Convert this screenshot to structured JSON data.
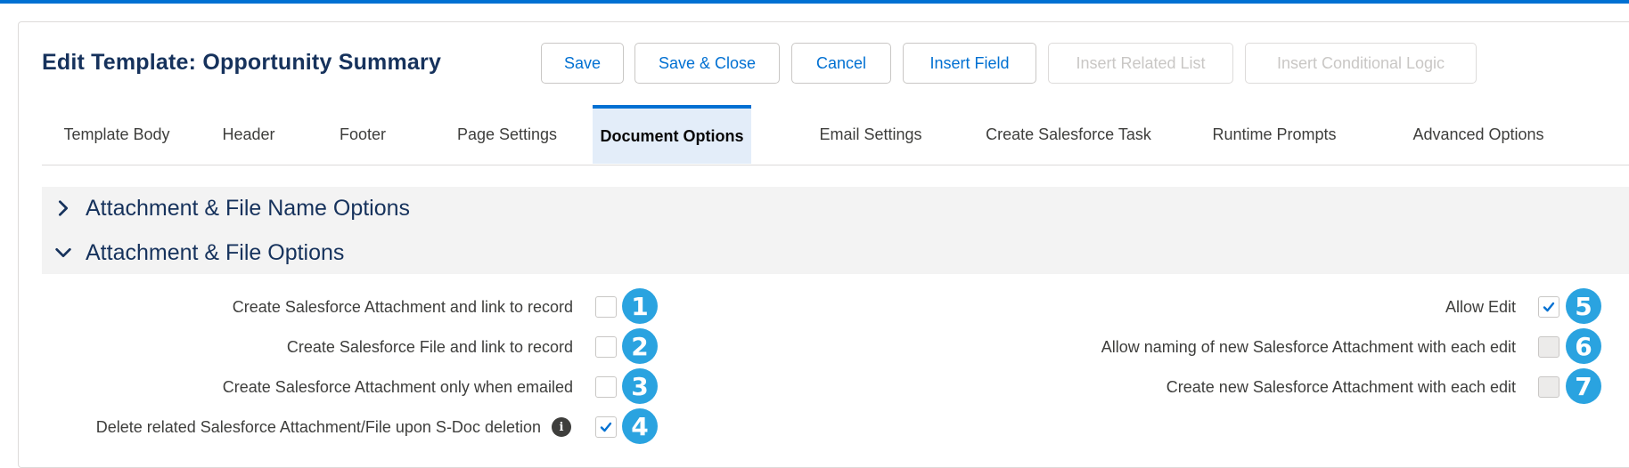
{
  "page": {
    "title": "Edit Template: Opportunity Summary"
  },
  "toolbar": {
    "save": "Save",
    "save_close": "Save & Close",
    "cancel": "Cancel",
    "insert_field": "Insert Field",
    "insert_related_list": "Insert Related List",
    "insert_conditional_logic": "Insert Conditional Logic"
  },
  "tabs": [
    {
      "label": "Template Body",
      "active": false
    },
    {
      "label": "Header",
      "active": false
    },
    {
      "label": "Footer",
      "active": false
    },
    {
      "label": "Page Settings",
      "active": false
    },
    {
      "label": "Document Options",
      "active": true
    },
    {
      "label": "Email Settings",
      "active": false
    },
    {
      "label": "Create Salesforce Task",
      "active": false
    },
    {
      "label": "Runtime Prompts",
      "active": false
    },
    {
      "label": "Advanced Options",
      "active": false
    }
  ],
  "sections": {
    "file_name_options": {
      "label": "Attachment & File Name Options",
      "expanded": false,
      "icon": "chevron-right-icon"
    },
    "file_options": {
      "label": "Attachment & File Options",
      "expanded": true,
      "icon": "chevron-down-icon"
    }
  },
  "options_left": [
    {
      "label": "Create Salesforce Attachment and link to record",
      "checked": false,
      "badge": "1"
    },
    {
      "label": "Create Salesforce File and link to record",
      "checked": false,
      "badge": "2"
    },
    {
      "label": "Create Salesforce Attachment only when emailed",
      "checked": false,
      "badge": "3"
    },
    {
      "label": "Delete related Salesforce Attachment/File upon S-Doc deletion",
      "checked": true,
      "badge": "4",
      "icon": "info-icon"
    }
  ],
  "options_right": [
    {
      "label": "Allow Edit",
      "checked": true,
      "disabled": false,
      "badge": "5"
    },
    {
      "label": "Allow naming of new Salesforce Attachment with each edit",
      "checked": false,
      "disabled": true,
      "badge": "6"
    },
    {
      "label": "Create new Salesforce Attachment with each edit",
      "checked": false,
      "disabled": true,
      "badge": "7"
    }
  ],
  "colors": {
    "brand": "#0070d2",
    "badge": "#2aa3e0",
    "heading": "#16325c"
  }
}
